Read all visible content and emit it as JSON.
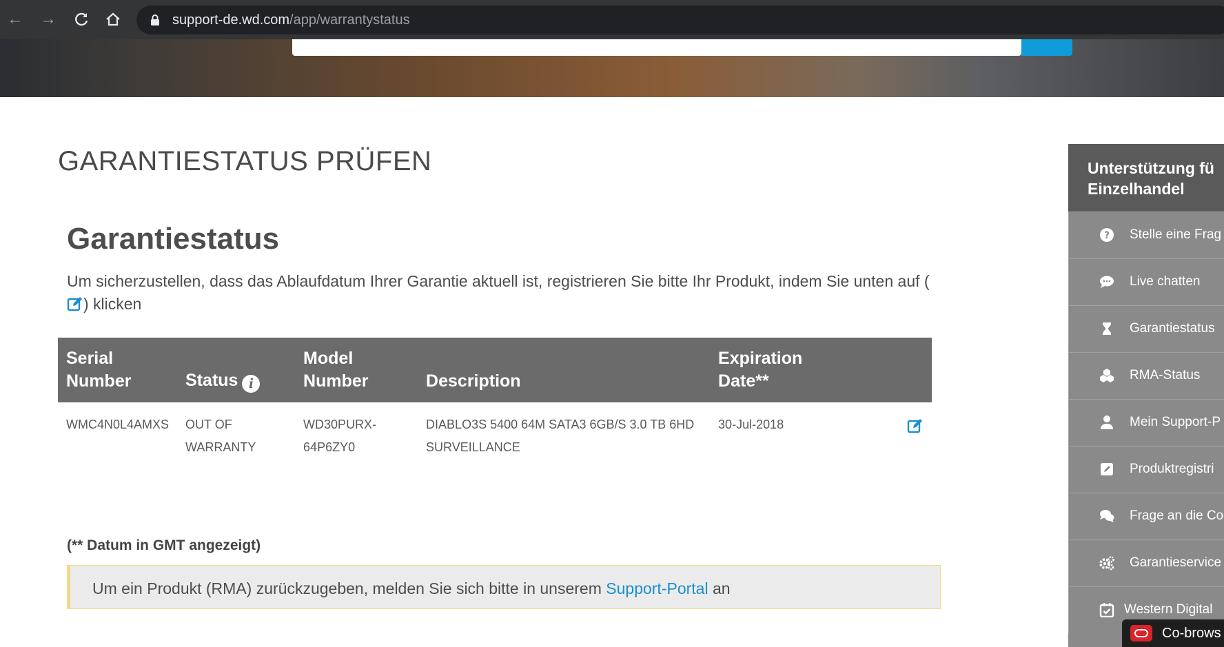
{
  "browser": {
    "url_host": "support-de.wd.com",
    "url_path": "/app/warrantystatus"
  },
  "page": {
    "title": "GARANTIESTATUS PRÜFEN",
    "section_title": "Garantiestatus",
    "intro_before": "Um sicherzustellen, dass das Ablaufdatum Ihrer Garantie aktuell ist, registrieren Sie bitte Ihr Produkt, indem Sie unten auf (",
    "intro_after": ") klicken"
  },
  "table": {
    "headers": {
      "serial": "Serial Number",
      "status": "Status",
      "model": "Model Number",
      "description": "Description",
      "expiration": "Expiration Date**"
    },
    "rows": [
      {
        "serial": "WMC4N0L4AMXS",
        "status": "OUT OF WARRANTY",
        "model": "WD30PURX-64P6ZY0",
        "description": "DIABLO3S 5400 64M SATA3 6GB/S 3.0 TB 6HD SURVEILLANCE",
        "expiration": "30-Jul-2018"
      }
    ]
  },
  "note": "(** Datum in GMT angezeigt)",
  "notice": {
    "before": "Um ein Produkt (RMA) zurückzugeben, melden Sie sich bitte in unserem ",
    "link": "Support-Portal",
    "after": " an"
  },
  "sidebar": {
    "heading_line1": "Unterstützung fü",
    "heading_line2": "Einzelhandel",
    "items": [
      {
        "label": "Stelle eine Frag",
        "icon": "question-icon"
      },
      {
        "label": "Live chatten",
        "icon": "chat-bubble-icon"
      },
      {
        "label": "Garantiestatus",
        "icon": "hourglass-icon"
      },
      {
        "label": "RMA-Status",
        "icon": "boxes-icon"
      },
      {
        "label": "Mein Support-P",
        "icon": "user-icon"
      },
      {
        "label": "Produktregistri",
        "icon": "edit-square-icon"
      },
      {
        "label": "Frage an die Co",
        "icon": "comments-icon"
      },
      {
        "label": "Garantieservice",
        "icon": "gears-icon"
      },
      {
        "label": "Western Digital",
        "icon": "calendar-check-icon"
      }
    ]
  },
  "cobrowse_label": "Co-brows",
  "colors": {
    "accent_blue": "#1a8fcc",
    "table_header": "#6b6b6b",
    "sidebar_bg": "#8a8a8a",
    "sidebar_head": "#5a5a5a"
  }
}
